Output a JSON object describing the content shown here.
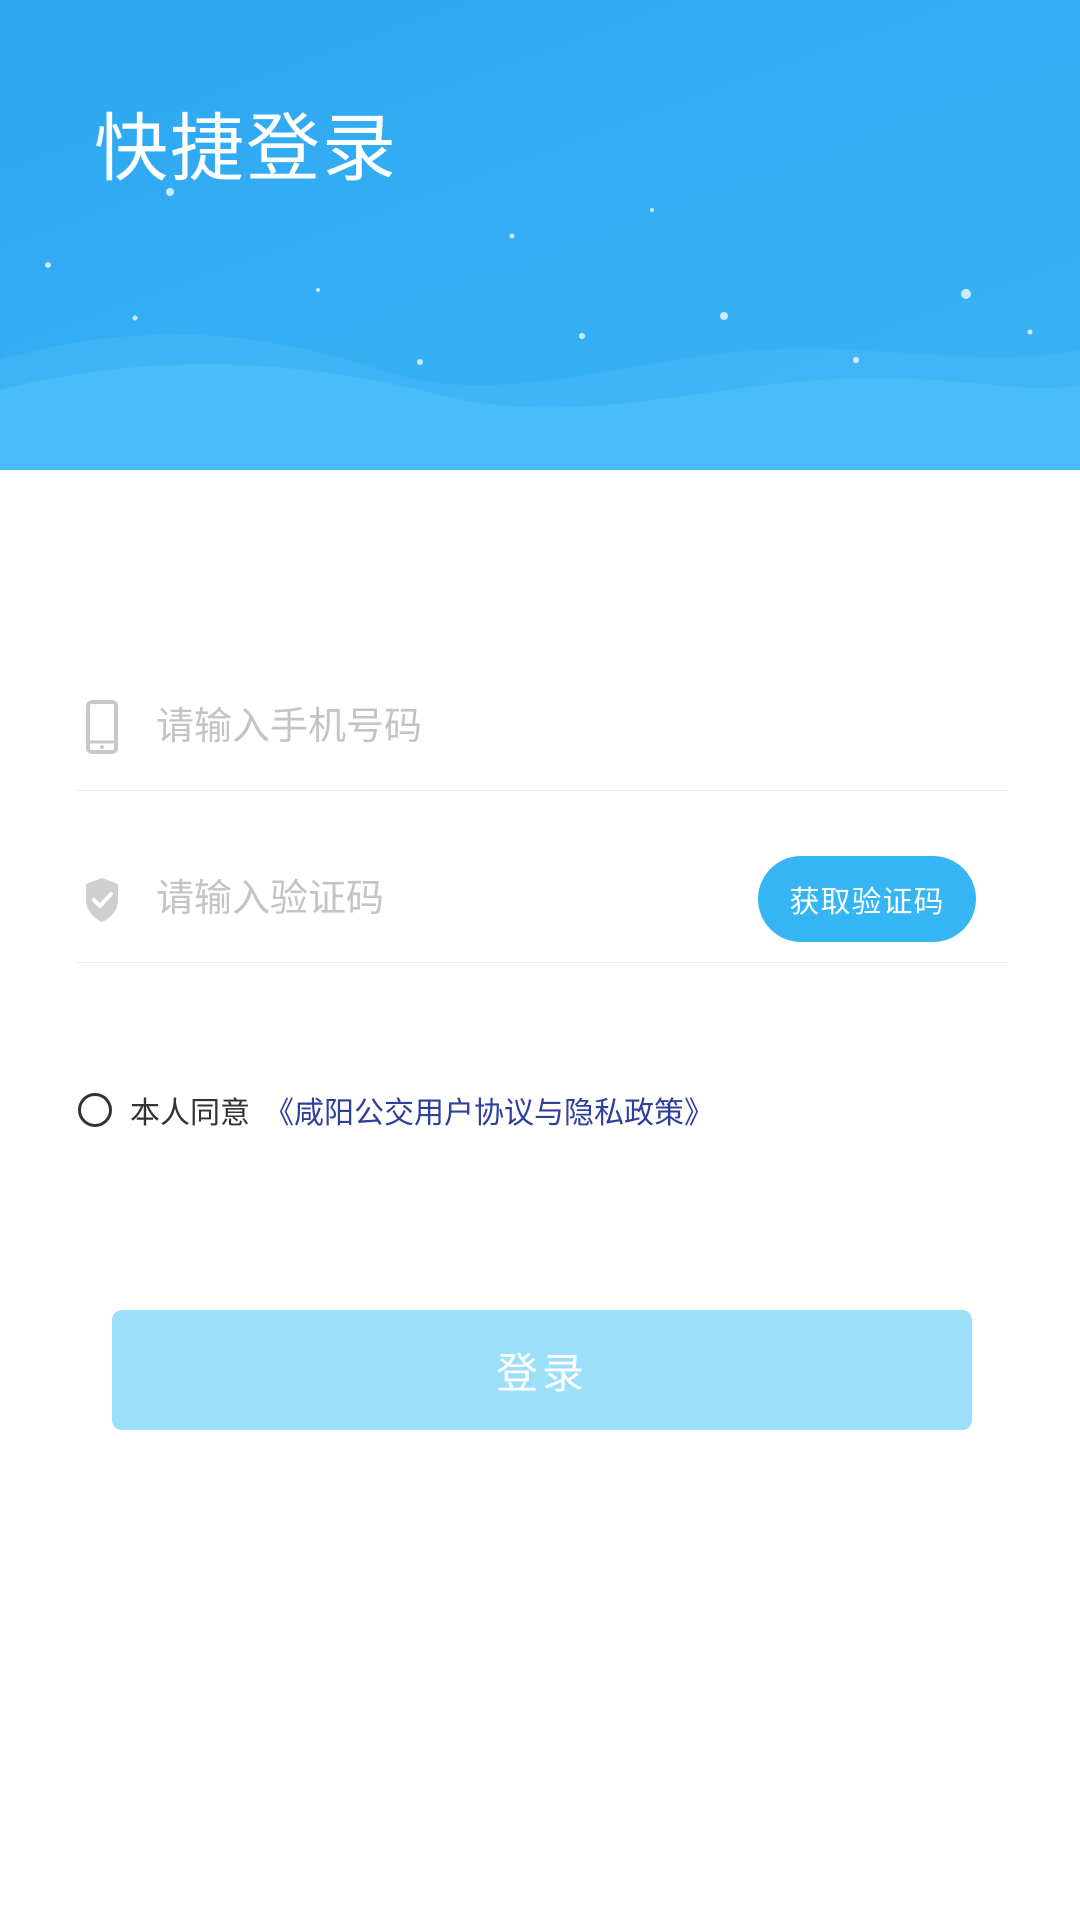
{
  "header": {
    "title": "快捷登录"
  },
  "form": {
    "phone": {
      "placeholder": "请输入手机号码",
      "icon": "phone-icon"
    },
    "code": {
      "placeholder": "请输入验证码",
      "icon": "shield-check-icon",
      "button_label": "获取验证码"
    },
    "agreement": {
      "prefix": "本人同意",
      "link": "《咸阳公交用户协议与隐私政策》"
    },
    "login_label": "登录"
  },
  "colors": {
    "header_blue": "#2da6f2",
    "code_button": "#35b5f3",
    "login_button_disabled": "#9cdffa",
    "link": "#2f3f9a"
  }
}
